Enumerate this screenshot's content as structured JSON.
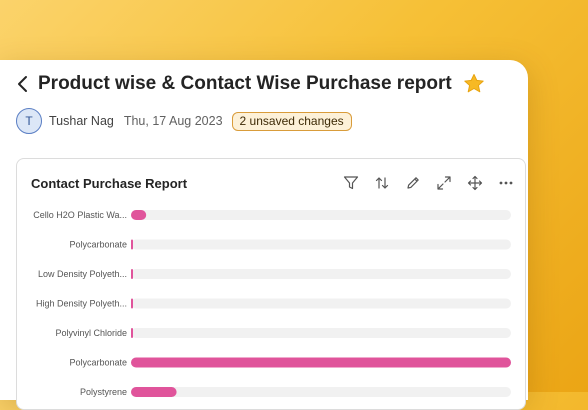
{
  "header": {
    "title": "Product wise & Contact Wise Purchase report",
    "back_icon": "chevron-left-icon",
    "star_icon": "star-icon"
  },
  "meta": {
    "avatar_initial": "T",
    "author": "Tushar Nag",
    "date": "Thu, 17 Aug 2023",
    "unsaved_badge": "2 unsaved changes"
  },
  "widget": {
    "title": "Contact Purchase Report",
    "toolbar": [
      "filter-icon",
      "sort-icon",
      "edit-icon",
      "expand-icon",
      "move-icon",
      "more-icon"
    ]
  },
  "chart_data": {
    "type": "bar",
    "orientation": "horizontal",
    "categories": [
      "Cello H2O Plastic Wa...",
      "Polycarbonate",
      "Low Density Polyeth...",
      "High Density Polyeth...",
      "Polyvinyl Chloride",
      "Polycarbonate",
      "Polystyrene"
    ],
    "values": [
      4,
      0.5,
      0.5,
      0.5,
      0.5,
      100,
      12
    ],
    "xlim": [
      0,
      100
    ],
    "bar_color": "#e0549b",
    "track_color": "#f1f1f1",
    "title": "Contact Purchase Report"
  },
  "colors": {
    "accent": "#e0549b",
    "badge_border": "#d99c3a",
    "avatar_border": "#5b7fc4"
  }
}
